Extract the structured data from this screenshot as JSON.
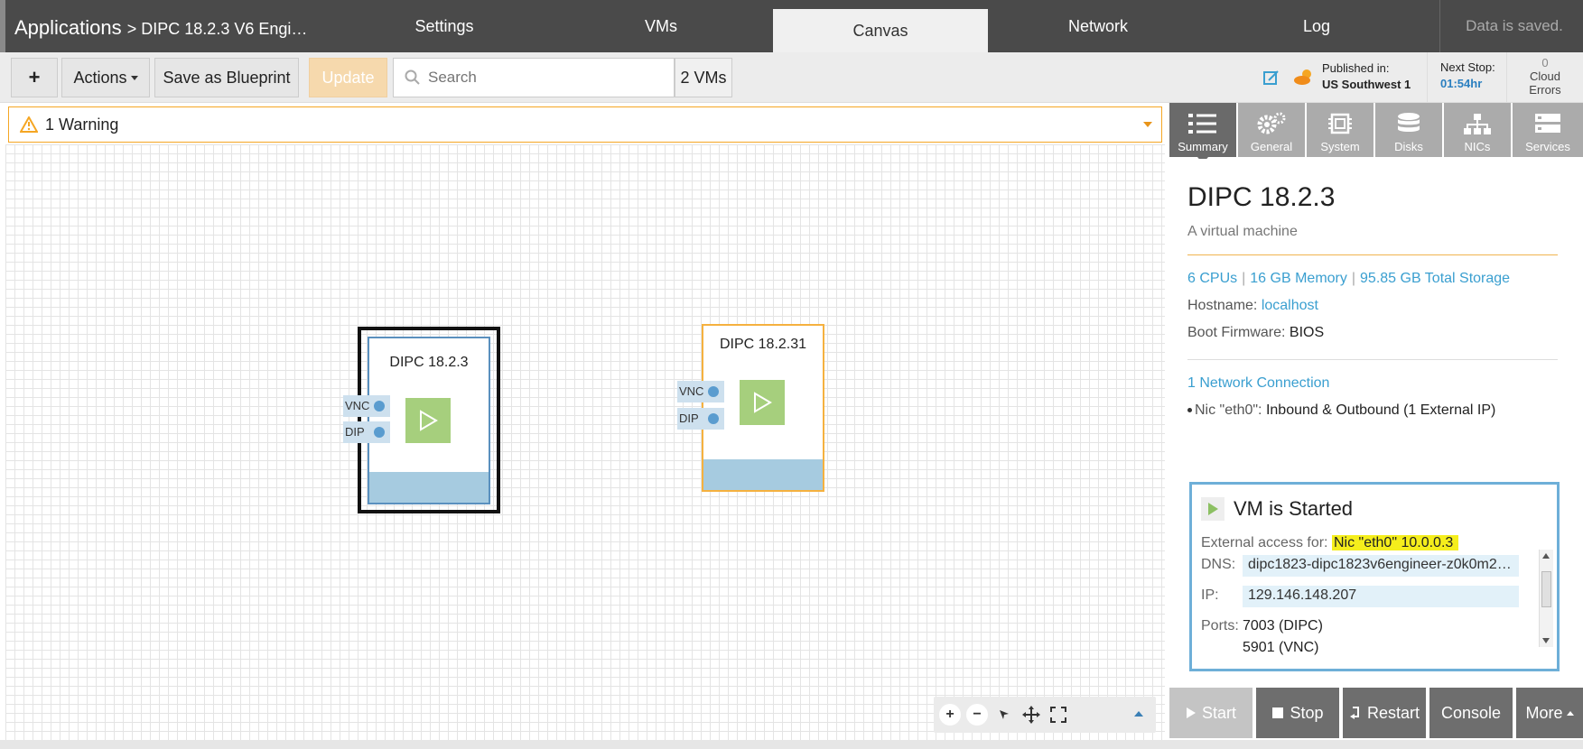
{
  "header": {
    "app_name": "Applications",
    "breadcrumb": "> DIPC 18.2.3 V6 Engi…",
    "tabs": [
      "Settings",
      "VMs",
      "Canvas",
      "Network",
      "Log"
    ],
    "active_tab": "Canvas",
    "save_status": "Data is saved."
  },
  "toolbar": {
    "add_label": "+",
    "actions_label": "Actions",
    "blueprint_label": "Save as Blueprint",
    "update_label": "Update",
    "search_placeholder": "Search",
    "vm_count": "2 VMs",
    "published_label": "Published in:",
    "published_region": "US Southwest 1",
    "next_stop_label": "Next Stop:",
    "next_stop_time": "01:54hr",
    "cloud_errors_count": "0",
    "cloud_errors_label1": "Cloud",
    "cloud_errors_label2": "Errors"
  },
  "warning": {
    "text": "1 Warning"
  },
  "canvas": {
    "vms": [
      {
        "name": "DIPC 18.2.3",
        "ports": [
          "VNC",
          "DIP"
        ],
        "selected": true
      },
      {
        "name": "DIPC 18.2.31",
        "ports": [
          "VNC",
          "DIP"
        ],
        "selected": false
      }
    ],
    "zoom_controls": [
      "zoom-in",
      "zoom-out",
      "select",
      "pan",
      "fit"
    ]
  },
  "right_panel": {
    "tabs": [
      "Summary",
      "General",
      "System",
      "Disks",
      "NICs",
      "Services"
    ],
    "active_tab": "Summary",
    "vm_title": "DIPC 18.2.3",
    "vm_desc": "A virtual machine",
    "cpus": "6 CPUs",
    "memory": "16 GB Memory",
    "storage": "95.85 GB Total Storage",
    "hostname_label": "Hostname:",
    "hostname": "localhost",
    "boot_label": "Boot Firmware:",
    "boot": "BIOS",
    "network_connections": "1 Network Connection",
    "nic_name": "Nic \"eth0\":",
    "nic_desc": "Inbound & Outbound (1 External IP)",
    "status": {
      "title": "VM is Started",
      "external_label": "External access for:",
      "external_value": "Nic \"eth0\" 10.0.0.3",
      "dns_label": "DNS:",
      "dns_value": "dipc1823-dipc1823v6engineer-z0k0m2…",
      "ip_label": "IP:",
      "ip_value": "129.146.148.207",
      "ports_label": "Ports:",
      "port1": "7003 (DIPC)",
      "port2": "5901 (VNC)"
    },
    "actions": {
      "start": "Start",
      "stop": "Stop",
      "restart": "Restart",
      "console": "Console",
      "more": "More"
    }
  },
  "colors": {
    "accent_blue": "#3a9fd0",
    "warning_orange": "#f5a623",
    "vm_play_green": "#a6cf7d",
    "highlight_yellow": "#f5ee1c"
  }
}
